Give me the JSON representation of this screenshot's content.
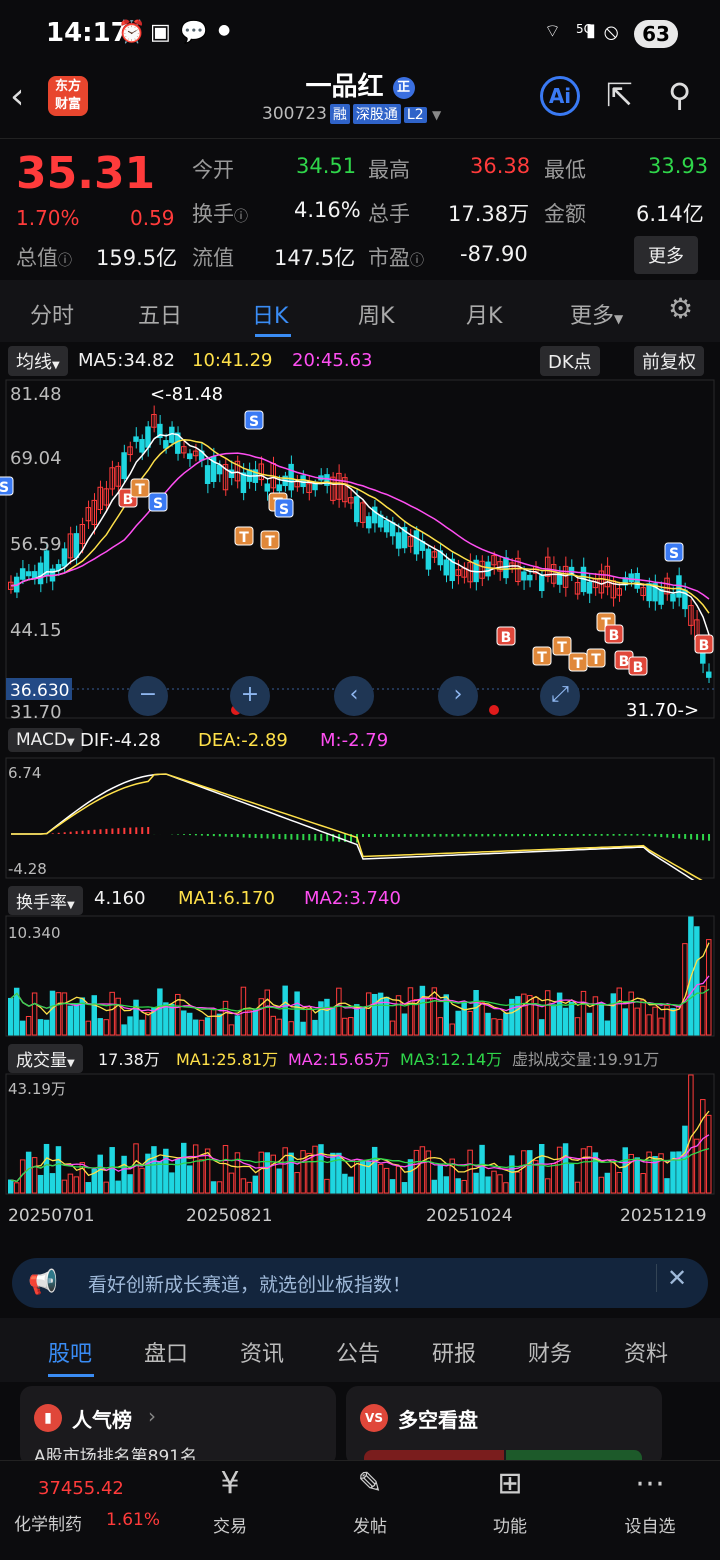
{
  "status": {
    "time": "14:17",
    "battery": "63",
    "signal": "5G"
  },
  "header": {
    "logo": "东方财富",
    "name": "一品红",
    "name_badge": "正",
    "code": "300723",
    "tags": [
      "融",
      "深股通",
      "L2"
    ],
    "ai": "Ai"
  },
  "quote": {
    "price": "35.31",
    "pct": "1.70%",
    "chg": "0.59",
    "open_label": "今开",
    "open": "34.51",
    "high_label": "最高",
    "high": "36.38",
    "low_label": "最低",
    "low": "33.93",
    "turnover_label": "换手",
    "turnover": "4.16%",
    "volume_label": "总手",
    "volume": "17.38万",
    "amount_label": "金额",
    "amount": "6.14亿",
    "mcap_label": "总值",
    "mcap": "159.5亿",
    "float_label": "流值",
    "float": "147.5亿",
    "pe_label": "市盈",
    "pe": "-87.90",
    "more": "更多"
  },
  "tabs": [
    "分时",
    "五日",
    "日K",
    "周K",
    "月K",
    "更多"
  ],
  "kline": {
    "ma_select": "均线",
    "ma5": "MA5:34.82",
    "ma10": "10:41.29",
    "ma20": "20:45.63",
    "dk": "DK点",
    "fq": "前复权",
    "ylabels": [
      "81.48",
      "69.04",
      "56.59",
      "44.15",
      "31.70"
    ],
    "max_label": "<-81.48",
    "min_label": "31.70->",
    "cursor_price": "36.630"
  },
  "macd": {
    "name": "MACD",
    "dif": "DIF:-4.28",
    "dea": "DEA:-2.89",
    "m": "M:-2.79",
    "top": "6.74",
    "bottom": "-4.28"
  },
  "turnover": {
    "name": "换手率",
    "val": "4.160",
    "ma1": "MA1:6.170",
    "ma2": "MA2:3.740",
    "top": "10.340"
  },
  "volume": {
    "name": "成交量",
    "val": "17.38万",
    "ma1": "MA1:25.81万",
    "ma2": "MA2:15.65万",
    "ma3": "MA3:12.14万",
    "virtual": "虚拟成交量:19.91万",
    "top": "43.19万"
  },
  "dates": [
    "20250701",
    "20250821",
    "20251024",
    "20251219"
  ],
  "promo": "看好创新成长赛道，就选创业板指数！",
  "bottom_tabs": [
    "股吧",
    "盘口",
    "资讯",
    "公告",
    "研报",
    "财务",
    "资料"
  ],
  "cards": {
    "hot": "人气榜",
    "hot_sub": "A股市场排名第891名",
    "longshort": "多空看盘"
  },
  "sector": {
    "value": "37455.42",
    "name": "化学制药",
    "pct": "1.61%"
  },
  "nav": [
    "交易",
    "发帖",
    "功能",
    "设自选"
  ]
}
